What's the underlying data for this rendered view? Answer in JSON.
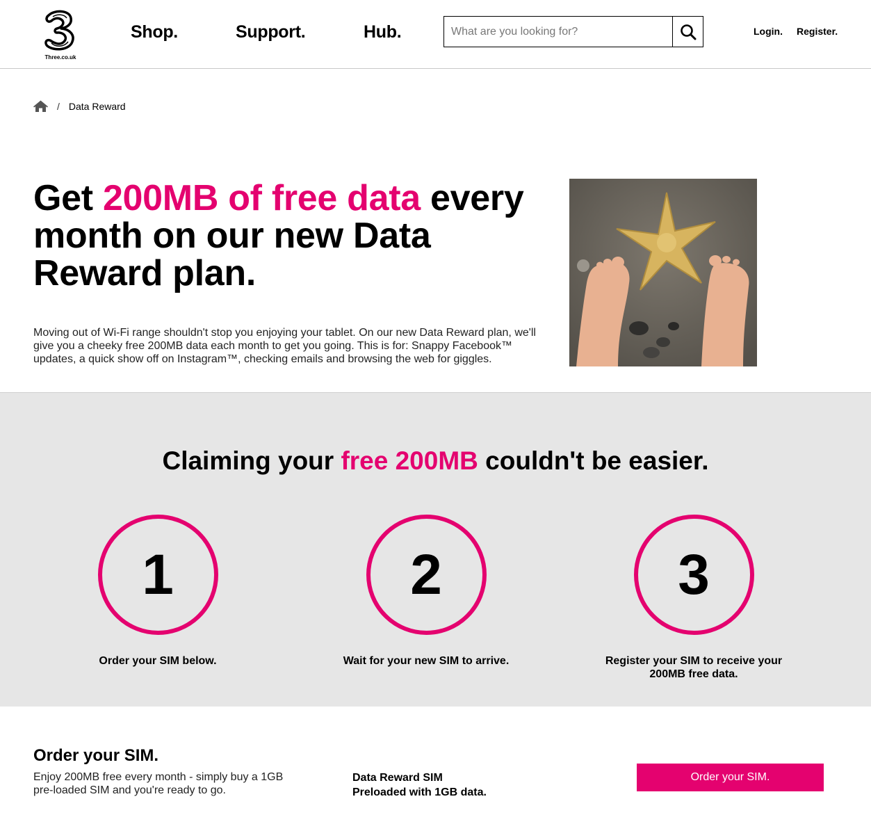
{
  "header": {
    "logo_text": "Three.co.uk",
    "nav": [
      {
        "label": "Shop."
      },
      {
        "label": "Support."
      },
      {
        "label": "Hub."
      }
    ],
    "search": {
      "placeholder": "What are you looking for?",
      "value": ""
    },
    "login_label": "Login.",
    "register_label": "Register."
  },
  "breadcrumb": {
    "separator": "/",
    "current": "Data Reward"
  },
  "hero": {
    "title_part1": "Get ",
    "title_highlight": "200MB of free data",
    "title_part2": " every month on our new Data Reward plan.",
    "body": "Moving out of Wi-Fi range shouldn't stop you enjoying your tablet. On our new Data Reward plan, we'll give you a cheeky free 200MB data each month to get you going. This is for: Snappy Facebook™ updates, a quick show off on Instagram™, checking emails and browsing the web for giggles."
  },
  "steps": {
    "title_part1": "Claiming your ",
    "title_highlight": "free 200MB",
    "title_part2": " couldn't be easier.",
    "items": [
      {
        "number": "1",
        "text": "Order your SIM below."
      },
      {
        "number": "2",
        "text": "Wait for your new SIM to arrive."
      },
      {
        "number": "3",
        "text": "Register your SIM to receive your 200MB free data."
      }
    ]
  },
  "order": {
    "title": "Order your SIM.",
    "body": "Enjoy 200MB free every month - simply buy a 1GB pre-loaded SIM and you're ready to go.",
    "product_name": "Data Reward SIM",
    "product_desc": "Preloaded with 1GB data.",
    "button_label": "Order your SIM."
  },
  "colors": {
    "accent": "#e4026f",
    "section_bg": "#e6e6e6"
  },
  "icons": [
    "three-logo-icon",
    "search-icon",
    "home-icon"
  ]
}
